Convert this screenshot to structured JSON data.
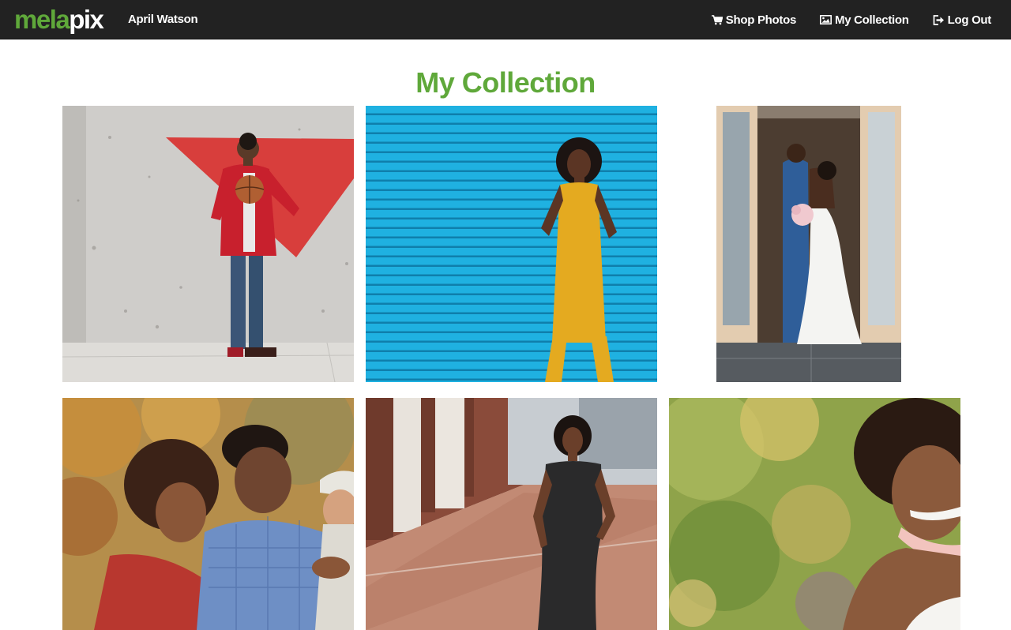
{
  "brand": {
    "part1": "mela",
    "part2": "pix"
  },
  "header": {
    "user_name": "April Watson"
  },
  "nav": {
    "shop_label": "Shop Photos",
    "collection_label": "My Collection",
    "logout_label": "Log Out",
    "shop_icon": "cart-icon",
    "collection_icon": "picture-icon",
    "logout_icon": "logout-icon"
  },
  "main": {
    "title": "My Collection"
  },
  "colors": {
    "brand_green": "#5fa83a",
    "navbar_bg": "#222222"
  }
}
